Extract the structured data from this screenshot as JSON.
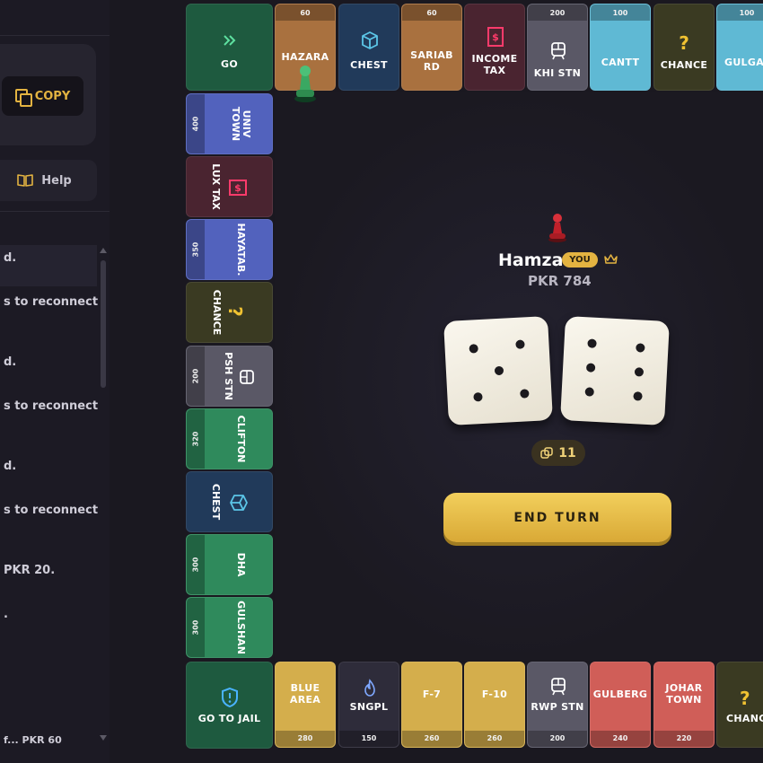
{
  "left_panel": {
    "copy_label": "COPY",
    "help_label": "Help",
    "log": [
      "d.",
      "s to reconnect",
      "d.",
      "s to reconnect",
      "d.",
      "s to reconnect",
      "PKR 20.",
      ".",
      "f... PKR 60"
    ]
  },
  "board": {
    "top": [
      {
        "name": "GO",
        "icon": "go-arrows-icon",
        "color": "#1e5a3f"
      },
      {
        "name": "HAZARA",
        "price": "60",
        "color": "#a9713f"
      },
      {
        "name": "CHEST",
        "icon": "chest-cube-icon",
        "color": "#213a5a"
      },
      {
        "name": "SARIAB RD",
        "price": "60",
        "color": "#a9713f"
      },
      {
        "name": "INCOME TAX",
        "icon": "tax-receipt-icon",
        "color": "#4a2430"
      },
      {
        "name": "KHI STN",
        "price": "200",
        "icon": "train-icon",
        "color": "#5a5866"
      },
      {
        "name": "CANTT",
        "price": "100",
        "color": "#5fb9d4"
      },
      {
        "name": "CHANCE",
        "icon": "question-icon",
        "color": "#3a3a22"
      },
      {
        "name": "GULGASHT",
        "price": "100",
        "color": "#5fb9d4"
      }
    ],
    "left": [
      {
        "name": "UNIV TOWN",
        "price": "400",
        "color": "#5262bd"
      },
      {
        "name": "LUX TAX",
        "icon": "tax-receipt-icon",
        "color": "#4a2430"
      },
      {
        "name": "HAYATAB.",
        "price": "350",
        "color": "#5262bd"
      },
      {
        "name": "CHANCE",
        "icon": "question-icon",
        "color": "#3a3a22"
      },
      {
        "name": "PSH STN",
        "price": "200",
        "icon": "train-icon",
        "color": "#5a5866"
      },
      {
        "name": "CLIFTON",
        "price": "320",
        "color": "#2f8a5c"
      },
      {
        "name": "CHEST",
        "icon": "chest-cube-icon",
        "color": "#213a5a"
      },
      {
        "name": "DHA",
        "price": "300",
        "color": "#2f8a5c"
      },
      {
        "name": "GULSHAN",
        "price": "300",
        "color": "#2f8a5c"
      }
    ],
    "bottom": [
      {
        "name": "GO TO JAIL",
        "icon": "jail-shield-icon",
        "color": "#1e5a3f"
      },
      {
        "name": "BLUE AREA",
        "price": "280",
        "color": "#d4ae4c"
      },
      {
        "name": "SNGPL",
        "price": "150",
        "icon": "flame-icon",
        "color": "#2e2c3a"
      },
      {
        "name": "F-7",
        "price": "260",
        "color": "#d4ae4c"
      },
      {
        "name": "F-10",
        "price": "260",
        "color": "#d4ae4c"
      },
      {
        "name": "RWP STN",
        "price": "200",
        "icon": "train-icon",
        "color": "#5a5866"
      },
      {
        "name": "GULBERG",
        "price": "240",
        "color": "#d05e58"
      },
      {
        "name": "JOHAR TOWN",
        "price": "220",
        "color": "#d05e58"
      },
      {
        "name": "CHANCE",
        "icon": "question-icon",
        "color": "#3a3a22"
      }
    ]
  },
  "player": {
    "name": "Hamza",
    "badge": "YOU",
    "money": "PKR 784",
    "token_color": "#c0202a"
  },
  "dice": {
    "die1": 5,
    "die2": 6,
    "total": "11"
  },
  "end_turn_label": "END TURN",
  "accent": "#e3b341"
}
